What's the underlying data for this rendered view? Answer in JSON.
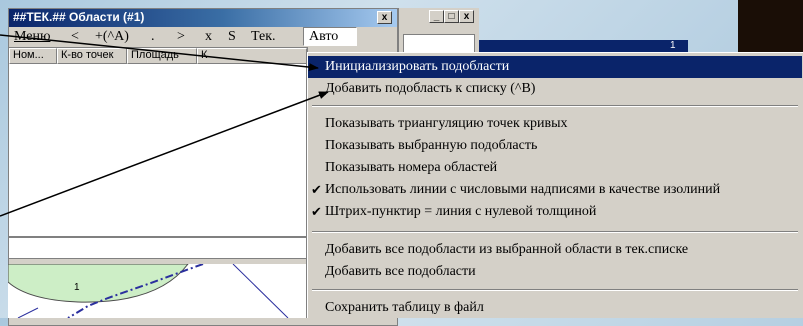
{
  "window": {
    "title": "##ТЕК.## Области (#1)",
    "close_glyph": "x",
    "min_glyph": "_",
    "max_glyph": "□"
  },
  "menubar": {
    "items": [
      "Меню",
      "<",
      "+(^A)",
      ".",
      ">",
      "x",
      "S",
      "Тек.",
      "Авто"
    ]
  },
  "table": {
    "columns": [
      "Ном...",
      "К-во точек",
      "Площадь",
      "К"
    ]
  },
  "canvas": {
    "label": "1"
  },
  "navy_label": "1",
  "context_menu": {
    "items": [
      {
        "label": "Инициализировать подобласти",
        "highlighted": true,
        "checked": false
      },
      {
        "label": "Добавить подобласть к списку (^B)",
        "checked": false
      },
      {
        "label": "Показывать триангуляцию точек кривых",
        "checked": false
      },
      {
        "label": "Показывать выбранную подобласть",
        "checked": false
      },
      {
        "label": "Показывать номера областей",
        "checked": false
      },
      {
        "label": "Использовать линии с числовыми надписями в качестве изолиний",
        "checked": true
      },
      {
        "label": "Штрих-пунктир = линия с нулевой толщиной",
        "checked": true
      },
      {
        "label": "Добавить все подобласти из выбранной области в тек.списке",
        "checked": false
      },
      {
        "label": "Добавить все подобласти",
        "checked": false
      },
      {
        "label": "Сохранить таблицу в файл",
        "checked": false
      }
    ],
    "check_glyph": "✔"
  },
  "colors": {
    "highlight": "#0a246a",
    "title_bar": "#0a246a",
    "face": "#d4d0c8",
    "canvas_fill": "#cdeec6",
    "line": "#2b2f9e"
  }
}
